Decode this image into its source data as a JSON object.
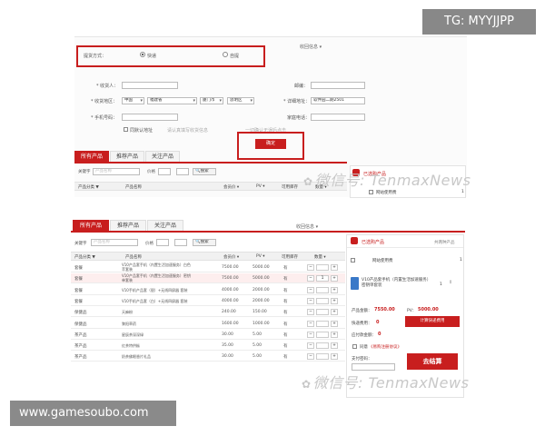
{
  "watermarks": {
    "top": "TG: MYYJJPP",
    "bottom": "www.gamesoubo.com",
    "wechat": "微信号: TenmaxNews"
  },
  "top_form": {
    "delivery_label": "提货方式：",
    "delivery_opt1": "快递",
    "delivery_opt2": "自提",
    "collapse_link": "收回信息 ▾",
    "receiver_label": "* 收货人：",
    "postcode_label": "邮编：",
    "region_label": "* 收货地区：",
    "region_country": "中国",
    "region_province": "福建省",
    "region_city": "厦门市",
    "region_district": "思明区",
    "address_label": "* 详细地址：",
    "address_value": "软件园二期2501",
    "mobile_label": "* 手机号码：",
    "phone_label": "家庭电话：",
    "same_as_home": "同默认地址",
    "hint_left": "请认真填写收货信息",
    "hint_right": "一切确认无误后点击",
    "confirm_button": "确定"
  },
  "tabs": [
    "所有产品",
    "推荐产品",
    "关注产品"
  ],
  "filters": {
    "keyword_label": "关键字",
    "keyword_placeholder": "产品名称",
    "price_label": "价格",
    "search_button": "搜索"
  },
  "table_headers": [
    "产品分类 ▼",
    "产品名称",
    "会员价 ▾",
    "PV ▾",
    "可用库存",
    "数量 ▾"
  ],
  "top_cart": {
    "title": "已选购产品",
    "item": "网站使用费",
    "qty": "1"
  },
  "bottom_panel": {
    "collapse_link": "收回信息 ▾",
    "cart_title": "已选购产品",
    "cart_count": "共两种产品",
    "cart_item1": "网站使用费",
    "cart_item1_qty": "1",
    "cart_item2": "V10产品套手机（内置生活加速服务）密钥单套装",
    "cart_item2_qty": "1",
    "total_label": "产品金额：",
    "total_value": "7550.00",
    "pv_label": "PV：",
    "pv_value": "5000.00",
    "shipping_label": "快递费用：",
    "shipping_value": "0",
    "calc_shipping_button": "计算快递费用",
    "total_due_label": "应付款金额：",
    "total_due_value": "0",
    "agree_label": "同意",
    "agree_link": "《易购注册协议》",
    "pay_pwd_label": "支付密码：",
    "checkout_button": "去结算"
  },
  "rows": [
    {
      "cat": "套餐",
      "name": "V10产品套手机（内置生活加速服务）白色\n苹套装",
      "price": "7500.00",
      "pv": "5000.00",
      "stock": "有",
      "qty": "",
      "highlight": false
    },
    {
      "cat": "套餐",
      "name": "V10产品套手机（内置生活加速服务）密钥\n单套装",
      "price": "7500.00",
      "pv": "5000.00",
      "stock": "有",
      "qty": "1",
      "highlight": true
    },
    {
      "cat": "套餐",
      "name": "V10手机产品套（银）+无线四屏器 套装",
      "price": "4000.00",
      "pv": "2000.00",
      "stock": "有",
      "qty": "",
      "highlight": false
    },
    {
      "cat": "套餐",
      "name": "V10手机产品套（白）+无线四屏器 套装",
      "price": "4000.00",
      "pv": "2000.00",
      "stock": "有",
      "qty": "",
      "highlight": false
    },
    {
      "cat": "保健品",
      "name": "天麻粉",
      "price": "240.00",
      "pv": "150.00",
      "stock": "有",
      "qty": "",
      "highlight": false
    },
    {
      "cat": "保健品",
      "name": "黎阳草药",
      "price": "1600.00",
      "pv": "1000.00",
      "stock": "有",
      "qty": "",
      "highlight": false
    },
    {
      "cat": "茶产品",
      "name": "星辰茶深深绿",
      "price": "30.00",
      "pv": "5.00",
      "stock": "有",
      "qty": "",
      "highlight": false
    },
    {
      "cat": "茶产品",
      "name": "红茶特供枞",
      "price": "35.00",
      "pv": "5.00",
      "stock": "有",
      "qty": "",
      "highlight": false
    },
    {
      "cat": "茶产品",
      "name": "奶茶佛眼香片礼品",
      "price": "30.00",
      "pv": "5.00",
      "stock": "有",
      "qty": "",
      "highlight": false
    }
  ]
}
